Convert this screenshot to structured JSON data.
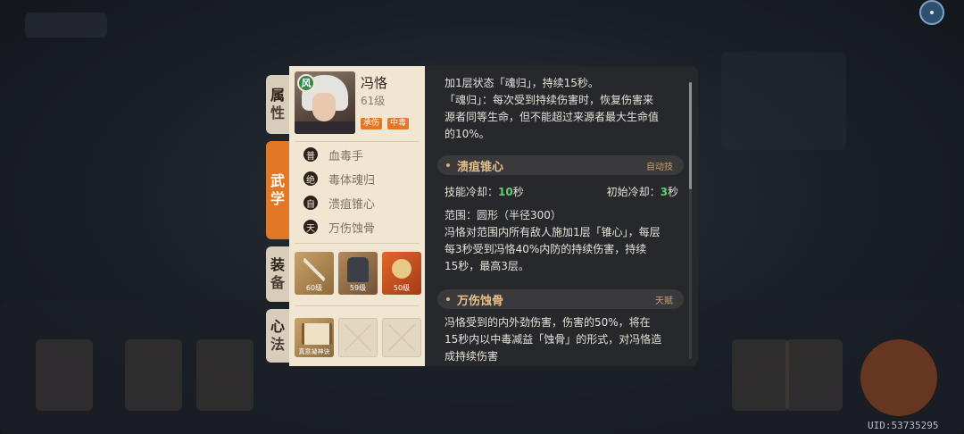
{
  "uid": "UID:53735295",
  "tabs": [
    {
      "top": "属",
      "bottom": "性"
    },
    {
      "top": "武",
      "bottom": "学"
    },
    {
      "top": "装",
      "bottom": "备"
    },
    {
      "top": "心",
      "bottom": "法"
    }
  ],
  "character": {
    "element": "风",
    "name": "冯恪",
    "level": "61级",
    "tags": [
      "承伤",
      "中毒"
    ]
  },
  "skills": [
    {
      "type": "普",
      "name": "血毒手"
    },
    {
      "type": "绝",
      "name": "毒体魂归"
    },
    {
      "type": "自",
      "name": "溃疽锥心"
    },
    {
      "type": "天",
      "name": "万伤蚀骨"
    }
  ],
  "equipment": [
    {
      "name": "weapon",
      "level": "60级"
    },
    {
      "name": "armor",
      "level": "59级"
    },
    {
      "name": "accessory",
      "level": "50级"
    }
  ],
  "mind_method": {
    "caption": "真意凝神诀"
  },
  "detail": {
    "intro_lines": [
      "加1层状态「魂归」，持续15秒。",
      "「魂归」：每次受到持续伤害时，恢复伤害来",
      "源者同等生命，但不能超过来源者最大生命值",
      "的10%。"
    ],
    "section1": {
      "title": "溃疽锥心",
      "type": "自动技",
      "cooldown_label": "技能冷却：",
      "cooldown_value": "10",
      "cooldown_unit": "秒",
      "initial_cd_label": "初始冷却：",
      "initial_cd_value": "3",
      "initial_cd_unit": "秒",
      "lines": [
        "范围：圆形（半径300）",
        "冯恪对范围内所有敌人施加1层「锥心」，每层",
        "每3秒受到冯恪40%内防的持续伤害，持续",
        "15秒，最高3层。"
      ]
    },
    "section2": {
      "title": "万伤蚀骨",
      "type": "天赋",
      "lines": [
        "冯恪受到的内外劲伤害，伤害的50%，将在",
        "15秒内以中毒减益「蚀骨」的形式，对冯恪造",
        "成持续伤害"
      ]
    }
  }
}
